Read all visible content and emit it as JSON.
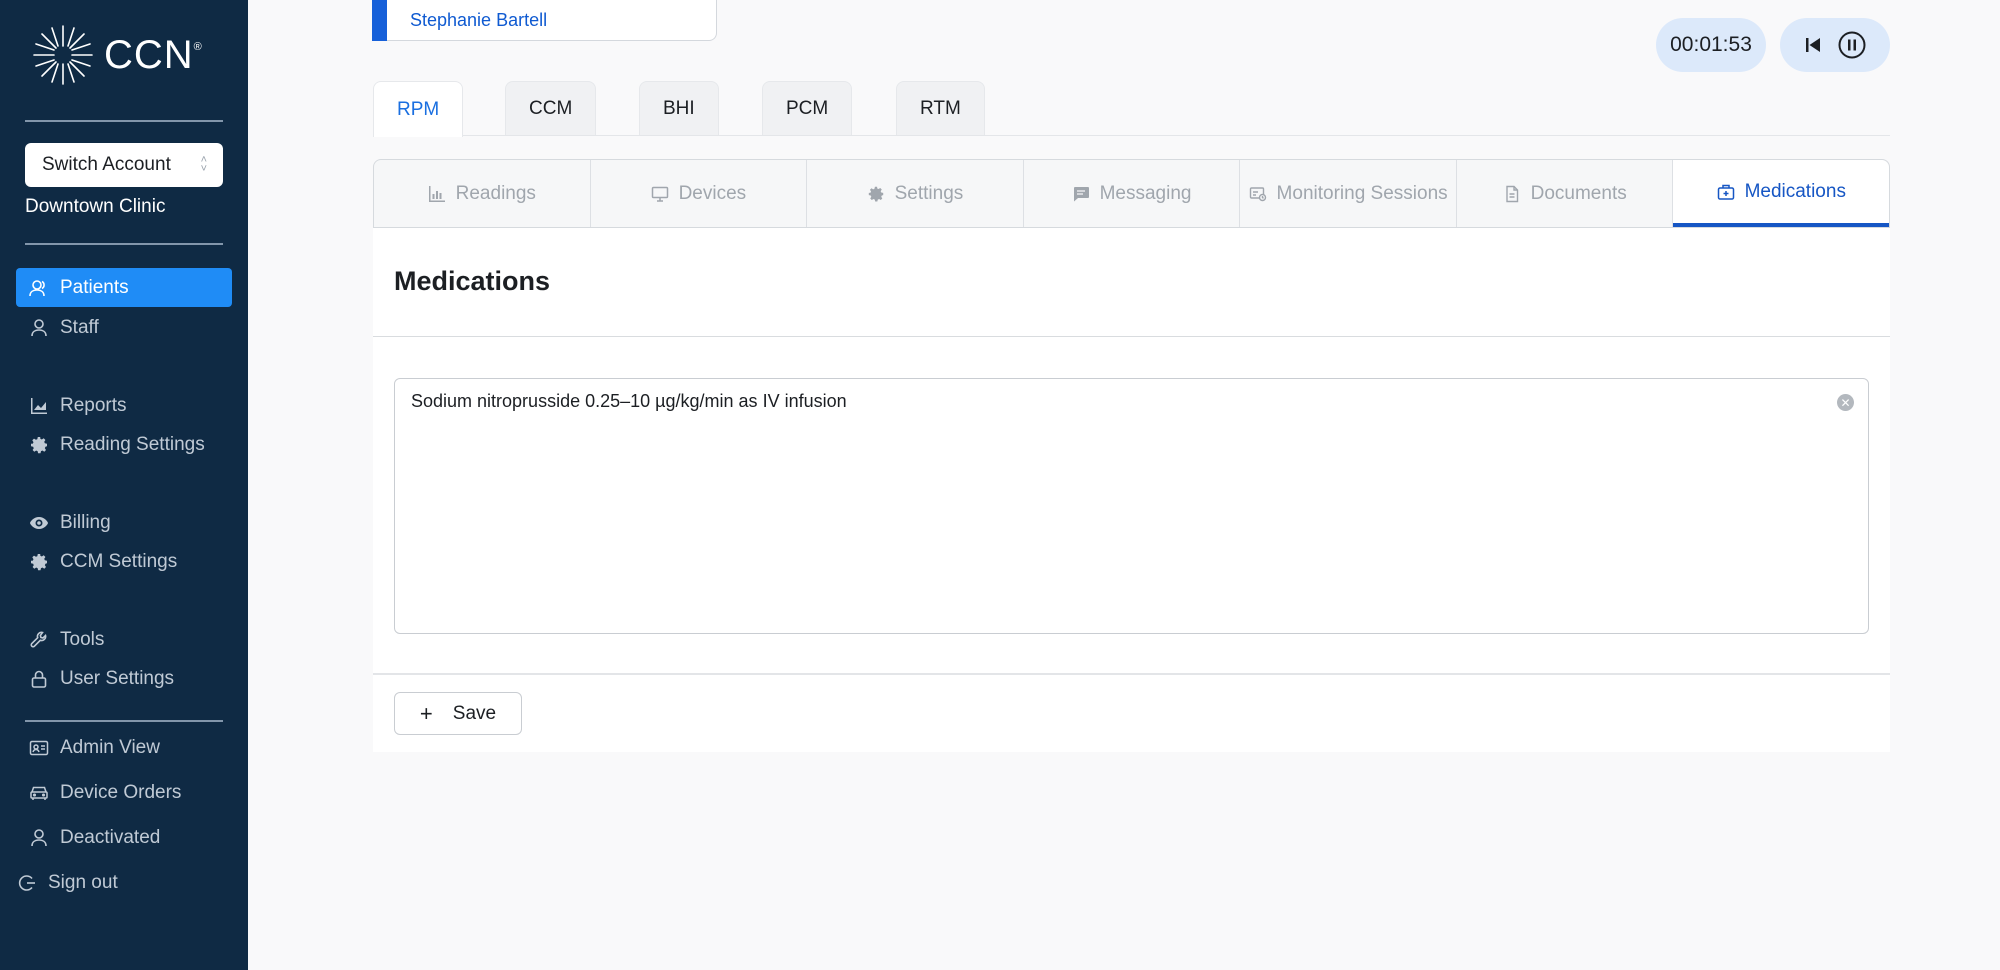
{
  "brand": {
    "name": "CCN",
    "mark": "®"
  },
  "sidebar": {
    "switch_account": "Switch Account",
    "clinic": "Downtown Clinic",
    "items": [
      {
        "label": "Patients",
        "icon": "patients-icon",
        "active": true
      },
      {
        "label": "Staff",
        "icon": "user-icon"
      },
      {
        "label": "Reports",
        "icon": "chart-icon"
      },
      {
        "label": "Reading Settings",
        "icon": "gear-icon"
      },
      {
        "label": "Billing",
        "icon": "eye-icon"
      },
      {
        "label": "CCM Settings",
        "icon": "gear-icon"
      },
      {
        "label": "Tools",
        "icon": "wrench-icon"
      },
      {
        "label": "User Settings",
        "icon": "lock-icon"
      },
      {
        "label": "Admin View",
        "icon": "id-card-icon"
      },
      {
        "label": "Device Orders",
        "icon": "truck-icon"
      },
      {
        "label": "Deactivated",
        "icon": "user-icon"
      },
      {
        "label": "Sign out",
        "icon": "sign-out-icon"
      }
    ]
  },
  "header": {
    "patient_name": "Stephanie Bartell",
    "timer": "00:01:53"
  },
  "program_tabs": [
    {
      "label": "RPM",
      "active": true
    },
    {
      "label": "CCM"
    },
    {
      "label": "BHI"
    },
    {
      "label": "PCM"
    },
    {
      "label": "RTM"
    }
  ],
  "section_tabs": [
    {
      "label": "Readings",
      "icon": "bar-chart-icon"
    },
    {
      "label": "Devices",
      "icon": "monitor-icon"
    },
    {
      "label": "Settings",
      "icon": "gear-icon"
    },
    {
      "label": "Messaging",
      "icon": "message-icon"
    },
    {
      "label": "Monitoring Sessions",
      "icon": "session-icon"
    },
    {
      "label": "Documents",
      "icon": "document-icon"
    },
    {
      "label": "Medications",
      "icon": "medical-kit-icon",
      "active": true
    }
  ],
  "panel": {
    "title": "Medications",
    "medications_value": "Sodium nitroprusside 0.25–10 µg/kg/min as IV infusion",
    "save_label": "Save"
  },
  "colors": {
    "sidebar_bg": "#0f2a44",
    "accent": "#1f8cf6",
    "tab_active": "#1656c4"
  }
}
